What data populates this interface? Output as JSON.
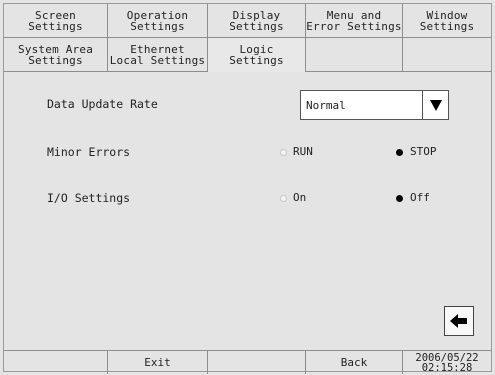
{
  "tabs_row1": [
    {
      "label": "Screen\nSettings"
    },
    {
      "label": "Operation\nSettings"
    },
    {
      "label": "Display\nSettings"
    },
    {
      "label": "Menu and\nError Settings"
    },
    {
      "label": "Window\nSettings"
    }
  ],
  "tabs_row2": [
    {
      "label": "System Area\nSettings"
    },
    {
      "label": "Ethernet\nLocal Settings"
    },
    {
      "label": "Logic\nSettings"
    }
  ],
  "settings": {
    "data_update_rate": {
      "label": "Data Update Rate",
      "value": "Normal"
    },
    "minor_errors": {
      "label": "Minor Errors",
      "options": [
        "RUN",
        "STOP"
      ],
      "selected": "STOP"
    },
    "io_settings": {
      "label": "I/O Settings",
      "options": [
        "On",
        "Off"
      ],
      "selected": "Off"
    }
  },
  "footer": {
    "exit_label": "Exit",
    "back_label": "Back",
    "datetime": "2006/05/22\n02:15:28"
  }
}
